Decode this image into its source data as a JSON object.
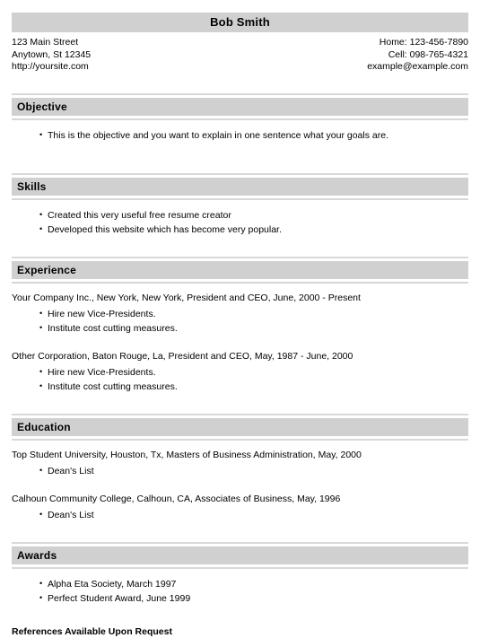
{
  "header": {
    "name": "Bob Smith",
    "contact_left": [
      "123 Main Street",
      "Anytown, St 12345",
      "http://yoursite.com"
    ],
    "contact_right": [
      "Home: 123-456-7890",
      "Cell: 098-765-4321",
      "example@example.com"
    ]
  },
  "sections": {
    "objective": {
      "title": "Objective",
      "bullets": [
        "This is the objective and you want to explain in one sentence what your goals are."
      ]
    },
    "skills": {
      "title": "Skills",
      "bullets": [
        "Created this very useful free resume creator",
        "Developed this website which has become very popular."
      ]
    },
    "experience": {
      "title": "Experience",
      "entries": [
        {
          "headline": "Your Company Inc., New York, New York, President and CEO, June, 2000 - Present",
          "bullets": [
            "Hire new Vice-Presidents.",
            "Institute cost cutting measures."
          ]
        },
        {
          "headline": "Other Corporation, Baton Rouge, La, President and CEO, May, 1987 - June, 2000",
          "bullets": [
            "Hire new Vice-Presidents.",
            "Institute cost cutting measures."
          ]
        }
      ]
    },
    "education": {
      "title": "Education",
      "entries": [
        {
          "headline": "Top Student University, Houston, Tx, Masters of Business Administration, May, 2000",
          "bullets": [
            "Dean's List"
          ]
        },
        {
          "headline": "Calhoun Community College, Calhoun, CA, Associates of Business, May, 1996",
          "bullets": [
            "Dean's List"
          ]
        }
      ]
    },
    "awards": {
      "title": "Awards",
      "bullets": [
        "Alpha Eta Society, March 1997",
        "Perfect Student Award, June 1999"
      ]
    }
  },
  "footer": {
    "references_note": "References Available Upon Request"
  },
  "colors": {
    "section_bar": "#d0d0d0",
    "rule": "#d8d8d8",
    "text": "#000000",
    "background": "#ffffff"
  }
}
